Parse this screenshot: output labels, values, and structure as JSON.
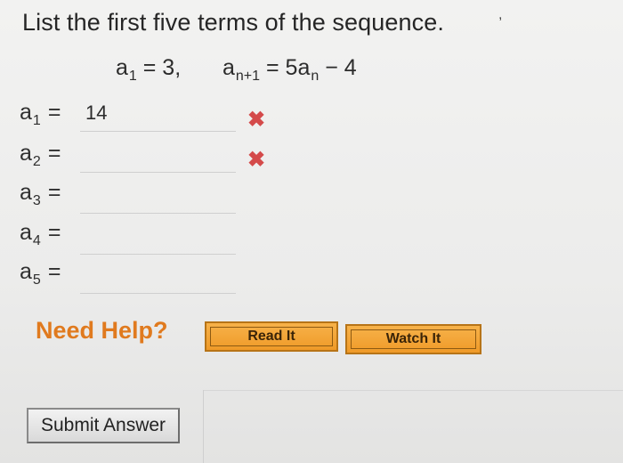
{
  "question": {
    "title": "List the first five terms of the sequence.",
    "corner_mark": ","
  },
  "formula": {
    "part1_base": "a",
    "part1_sub": "1",
    "part1_rest": "= 3,",
    "part2_base": "a",
    "part2_sub": "n+1",
    "part2_mid": "= 5a",
    "part2_sub2": "n",
    "part2_rest": "− 4"
  },
  "terms": [
    {
      "base": "a",
      "sub": "1",
      "eq": "=",
      "value": "14",
      "status": "✖"
    },
    {
      "base": "a",
      "sub": "2",
      "eq": "=",
      "value": "",
      "status": "✖"
    },
    {
      "base": "a",
      "sub": "3",
      "eq": "=",
      "value": "",
      "status": ""
    },
    {
      "base": "a",
      "sub": "4",
      "eq": "=",
      "value": "",
      "status": ""
    },
    {
      "base": "a",
      "sub": "5",
      "eq": "=",
      "value": "",
      "status": ""
    }
  ],
  "help": {
    "label": "Need Help?",
    "read_it": "Read It",
    "watch_it": "Watch It"
  },
  "submit": {
    "label": "Submit Answer"
  },
  "colors": {
    "incorrect_mark": "#d44a4a",
    "help_accent": "#e07a1e",
    "help_button": "#ef9a28"
  }
}
